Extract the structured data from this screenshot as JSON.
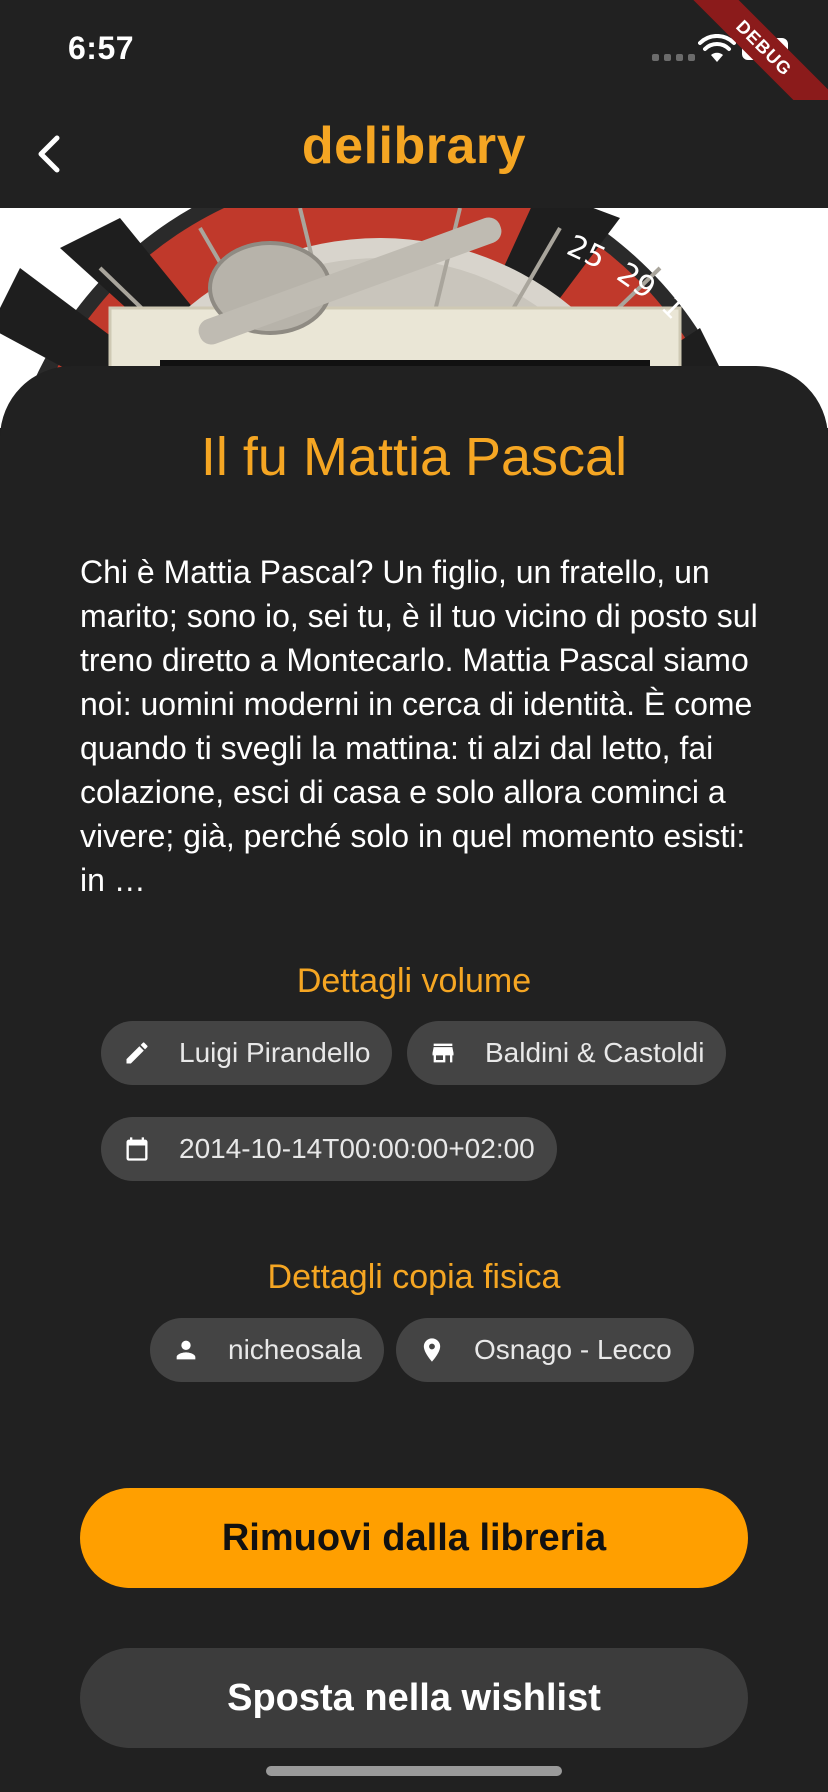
{
  "status": {
    "time": "6:57",
    "debug_label": "DEBUG"
  },
  "appbar": {
    "title": "delibrary"
  },
  "book": {
    "title": "Il fu Mattia Pascal",
    "description": "Chi è Mattia Pascal? Un figlio, un fratello, un marito; sono io, sei tu, è il tuo vicino di posto sul treno diretto a Montecarlo. Mattia Pascal siamo noi: uomini moderni in cerca di identità. È come quando ti svegli la mattina: ti alzi dal letto, fai colazione, esci di casa e solo allora cominci a vivere; già, perché solo in quel momento esisti: in …"
  },
  "volume": {
    "heading": "Dettagli volume",
    "author": {
      "icon": "pencil-icon",
      "label": "Luigi Pirandello"
    },
    "publisher": {
      "icon": "store-icon",
      "label": "Baldini & Castoldi"
    },
    "date": {
      "icon": "calendar-icon",
      "label": "2014-10-14T00:00:00+02:00"
    }
  },
  "copy": {
    "heading": "Dettagli copia fisica",
    "owner": {
      "icon": "person-icon",
      "label": "nicheosala"
    },
    "location": {
      "icon": "location-pin-icon",
      "label": "Osnago - Lecco"
    }
  },
  "actions": {
    "remove_label": "Rimuovi dalla libreria",
    "wishlist_label": "Sposta nella wishlist"
  },
  "colors": {
    "accent": "#f5a623",
    "button_primary": "#ff9f00",
    "background": "#212121",
    "chip": "#444444"
  }
}
